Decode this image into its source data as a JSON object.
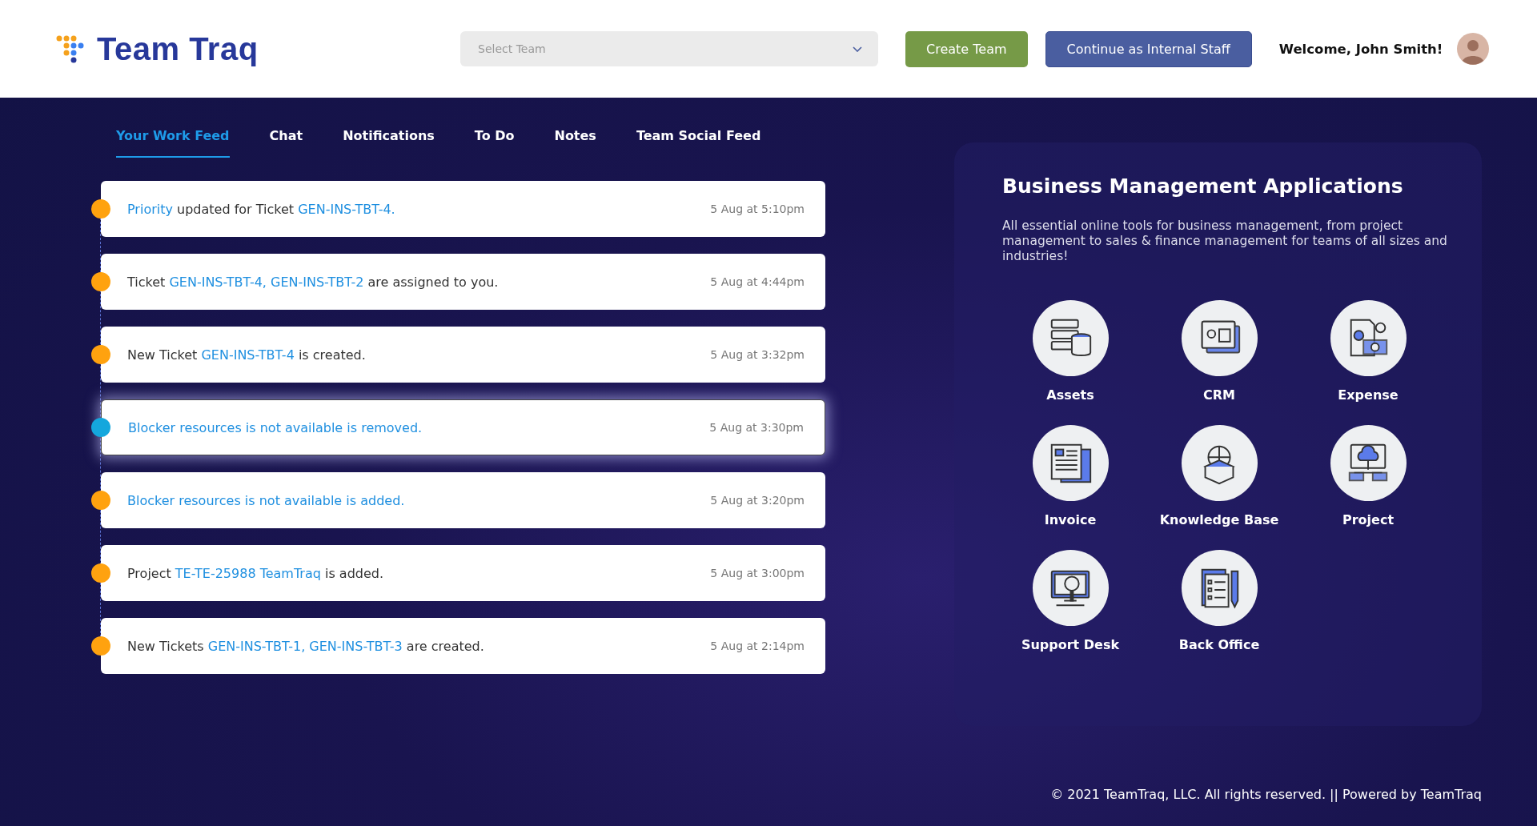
{
  "header": {
    "logo": "Team Traq",
    "team_select": {
      "placeholder": "Select Team"
    },
    "buttons": [
      {
        "label": "Create Team",
        "kind": "create"
      },
      {
        "label": "Continue as Internal Staff",
        "kind": "staff"
      }
    ],
    "welcome": "Welcome, John Smith!"
  },
  "tabs": [
    {
      "label": "Your Work Feed",
      "selected": true
    },
    {
      "label": "Chat",
      "selected": false
    },
    {
      "label": "Notifications",
      "selected": false
    },
    {
      "label": "To Do",
      "selected": false
    },
    {
      "label": "Notes",
      "selected": false
    },
    {
      "label": "Team Social Feed",
      "selected": false
    }
  ],
  "feed": [
    {
      "selected": false,
      "time": "5 Aug at 5:10pm",
      "parts": [
        {
          "text": "Priority",
          "link": true
        },
        {
          "text": " updated for Ticket ",
          "link": false
        },
        {
          "text": "GEN-INS-TBT-4.",
          "link": true
        }
      ]
    },
    {
      "selected": false,
      "time": "5 Aug at 4:44pm",
      "parts": [
        {
          "text": "Ticket ",
          "link": false
        },
        {
          "text": "GEN-INS-TBT-4, GEN-INS-TBT-2",
          "link": true
        },
        {
          "text": " are assigned to you.",
          "link": false
        }
      ]
    },
    {
      "selected": false,
      "time": "5 Aug at 3:32pm",
      "parts": [
        {
          "text": "New Ticket ",
          "link": false
        },
        {
          "text": "GEN-INS-TBT-4",
          "link": true
        },
        {
          "text": " is created.",
          "link": false
        }
      ]
    },
    {
      "selected": true,
      "time": "5 Aug at 3:30pm",
      "parts": [
        {
          "text": "Blocker resources is not available is removed.",
          "link": true
        }
      ]
    },
    {
      "selected": false,
      "time": "5 Aug at 3:20pm",
      "parts": [
        {
          "text": "Blocker resources is not available is added.",
          "link": true
        }
      ]
    },
    {
      "selected": false,
      "time": "5 Aug at 3:00pm",
      "parts": [
        {
          "text": "Project ",
          "link": false
        },
        {
          "text": "TE-TE-25988 TeamTraq",
          "link": true
        },
        {
          "text": " is added.",
          "link": false
        }
      ]
    },
    {
      "selected": false,
      "time": "5 Aug at 2:14pm",
      "parts": [
        {
          "text": "New Tickets ",
          "link": false
        },
        {
          "text": "GEN-INS-TBT-1, GEN-INS-TBT-3",
          "link": true
        },
        {
          "text": " are created.",
          "link": false
        }
      ]
    }
  ],
  "apps_panel": {
    "title": "Business Management Applications",
    "description": "All essential online tools for business management, from project management to sales & finance management for teams of all sizes and industries!",
    "apps": [
      {
        "label": "Assets"
      },
      {
        "label": "CRM"
      },
      {
        "label": "Expense"
      },
      {
        "label": "Invoice"
      },
      {
        "label": "Knowledge Base"
      },
      {
        "label": "Project"
      },
      {
        "label": "Support Desk"
      },
      {
        "label": "Back Office"
      }
    ]
  },
  "footer": "© 2021 TeamTraq, LLC. All rights reserved. || Powered by TeamTraq"
}
